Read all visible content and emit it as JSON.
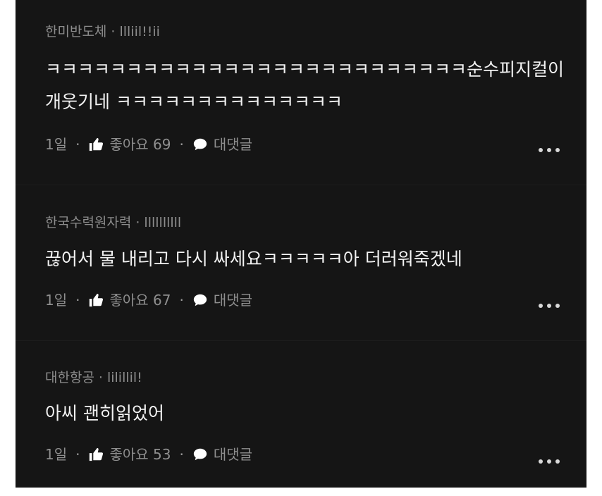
{
  "comments": [
    {
      "author": "한미반도체",
      "handle": "llliil!!ii",
      "body_lines": [
        "ㅋㅋㅋㅋㅋㅋㅋㅋㅋㅋㅋㅋㅋㅋㅋㅋㅋㅋㅋㅋㅋㅋㅋㅋㅋㅋ순수피지컬이",
        "개웃기네 ㅋㅋㅋㅋㅋㅋㅋㅋㅋㅋㅋㅋㅋㅋ"
      ],
      "age": "1일",
      "like_label": "좋아요",
      "like_count": "69",
      "reply_label": "대댓글"
    },
    {
      "author": "한국수력원자력",
      "handle": "llllllllll",
      "body_lines": [
        "끊어서 물 내리고 다시 싸세요ㅋㅋㅋㅋㅋ아 더러워죽겠네"
      ],
      "age": "1일",
      "like_label": "좋아요",
      "like_count": "67",
      "reply_label": "대댓글"
    },
    {
      "author": "대한항공",
      "handle": "lilillil!",
      "body_lines": [
        "아씨 괜히읽었어"
      ],
      "age": "1일",
      "like_label": "좋아요",
      "like_count": "53",
      "reply_label": "대댓글"
    }
  ],
  "separator": "·",
  "icons": {
    "like": "thumbs-up-icon",
    "reply": "speech-bubble-icon",
    "more": "more-dots-icon"
  },
  "colors": {
    "background": "#151515",
    "body_text": "#f2f2f2",
    "meta_text": "#8c8c8c"
  }
}
